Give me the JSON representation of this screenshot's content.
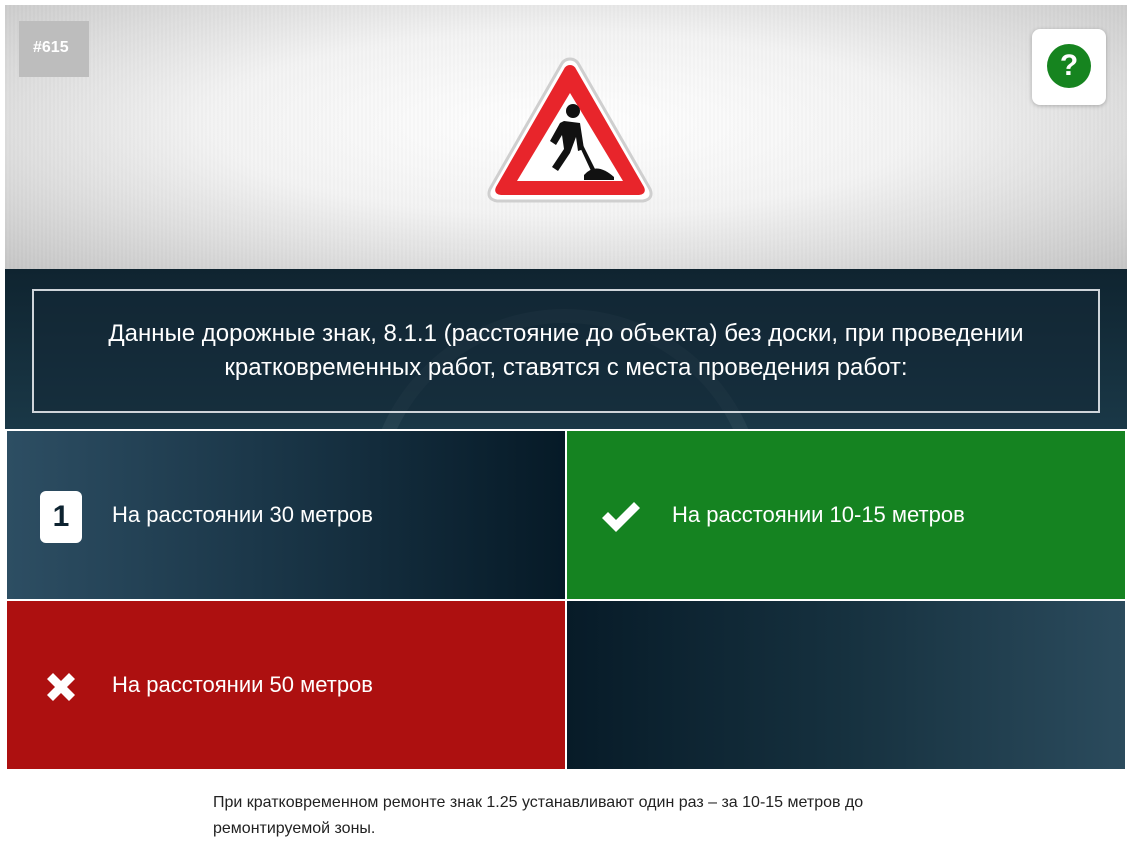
{
  "quiz": {
    "number": "#615",
    "help_label": "?",
    "sign_name": "road-works-sign",
    "question": "Данные дорожные знак, 8.1.1 (расстояние до объекта) без доски, при проведении кратковременных работ, ставятся с места проведения работ:",
    "answers": [
      {
        "marker": "1",
        "state": "unanswered",
        "label": "На расстоянии 30 метров"
      },
      {
        "marker": "check-icon",
        "state": "correct",
        "label": "На расстоянии 10-15 метров"
      },
      {
        "marker": "cross-icon",
        "state": "wrong",
        "label": "На расстоянии 50 метров"
      },
      {
        "marker": "",
        "state": "empty",
        "label": ""
      }
    ],
    "explanation": "При кратковременном ремонте знак 1.25 устанавливают один раз – за 10-15 метров до ремонтируемой зоны."
  },
  "colors": {
    "correct": "#158321",
    "wrong": "#ad1010",
    "dark": "#0f2430",
    "help_icon": "#16841f",
    "sign_border": "#e8252b"
  }
}
